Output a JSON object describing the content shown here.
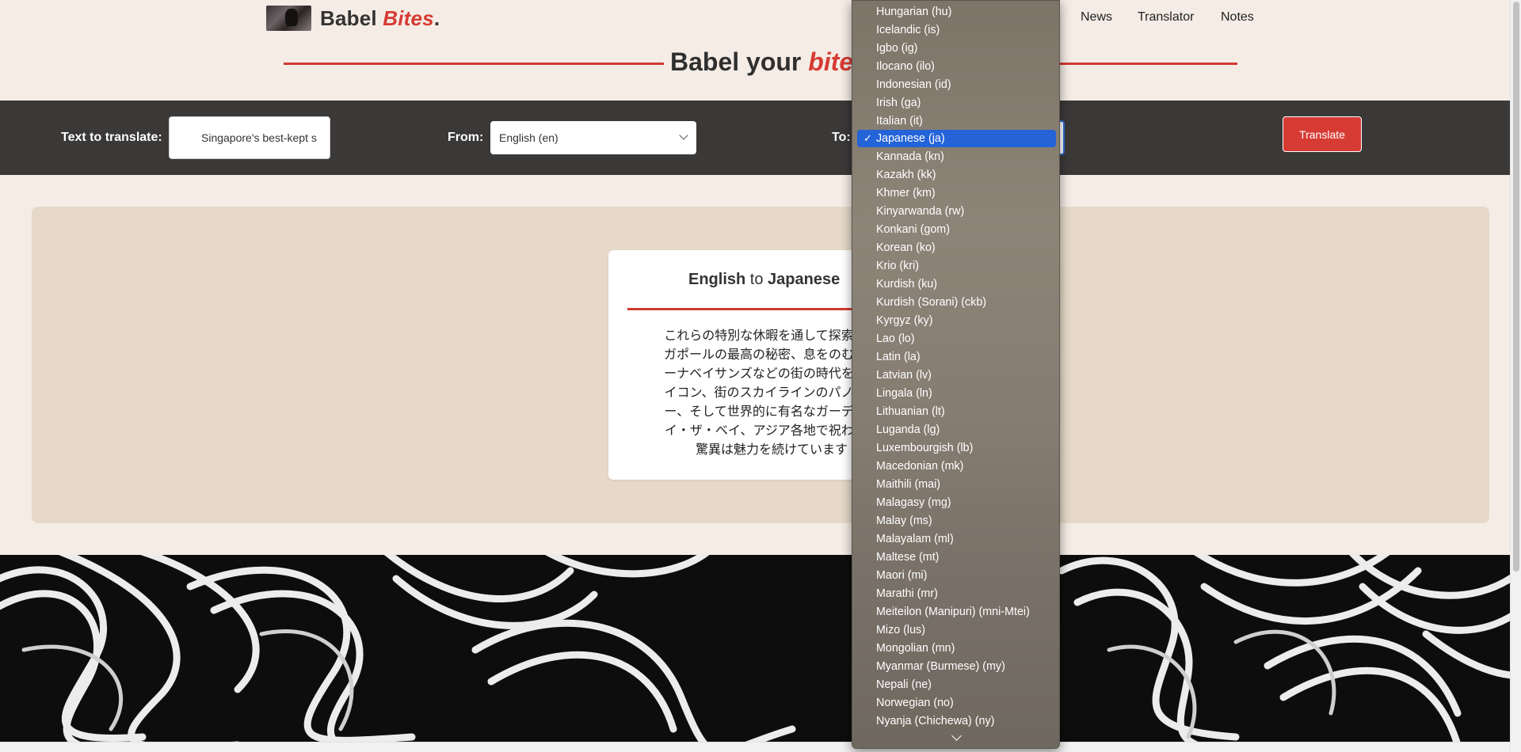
{
  "header": {
    "brand_name": "Babel",
    "brand_accent": "Bites",
    "brand_period": ".",
    "nav": [
      "News",
      "Translator",
      "Notes"
    ]
  },
  "tagline": {
    "prefix": "Babel your",
    "accent": "bites",
    "suffix": ":"
  },
  "toolbar": {
    "text_label": "Text to translate:",
    "text_value": "Singapore's best-kept s",
    "from_label": "From:",
    "from_value": "English (en)",
    "to_label": "To:",
    "translate_label": "Translate"
  },
  "result": {
    "source_language": "English",
    "connector": "to",
    "target_language": "Japanese",
    "text_lines": [
      "これらの特別な休暇を通して探索され",
      "ガポールの最高の秘密、息をのむよう",
      "ーナベイサンズなどの街の時代を超越",
      "イコン、街のスカイラインのパノラマ",
      "ー、そして世界的に有名なガーデンズ",
      "イ・ザ・ベイ、アジア各地で祝われる",
      "驚異は魅力を続けています"
    ]
  },
  "dropdown": {
    "selected": "Japanese (ja)",
    "items": [
      "Hungarian (hu)",
      "Icelandic (is)",
      "Igbo (ig)",
      "Ilocano (ilo)",
      "Indonesian (id)",
      "Irish (ga)",
      "Italian (it)",
      "Japanese (ja)",
      "Kannada (kn)",
      "Kazakh (kk)",
      "Khmer (km)",
      "Kinyarwanda (rw)",
      "Konkani (gom)",
      "Korean (ko)",
      "Krio (kri)",
      "Kurdish (ku)",
      "Kurdish (Sorani) (ckb)",
      "Kyrgyz (ky)",
      "Lao (lo)",
      "Latin (la)",
      "Latvian (lv)",
      "Lingala (ln)",
      "Lithuanian (lt)",
      "Luganda (lg)",
      "Luxembourgish (lb)",
      "Macedonian (mk)",
      "Maithili (mai)",
      "Malagasy (mg)",
      "Malay (ms)",
      "Malayalam (ml)",
      "Maltese (mt)",
      "Maori (mi)",
      "Marathi (mr)",
      "Meiteilon (Manipuri) (mni-Mtei)",
      "Mizo (lus)",
      "Mongolian (mn)",
      "Myanmar (Burmese) (my)",
      "Nepali (ne)",
      "Norwegian (no)",
      "Nyanja (Chichewa) (ny)"
    ]
  },
  "colors": {
    "accent": "#d63b34",
    "toolbar_bg": "#3b3838",
    "page_bg": "#f4ece5",
    "panel_bg": "#e6d9c8",
    "selected_item": "#2463d8"
  },
  "icons": {
    "select_arrow": "chevron-down-icon",
    "checkmark": "checkmark-icon",
    "scroll_more": "chevron-down-icon"
  }
}
